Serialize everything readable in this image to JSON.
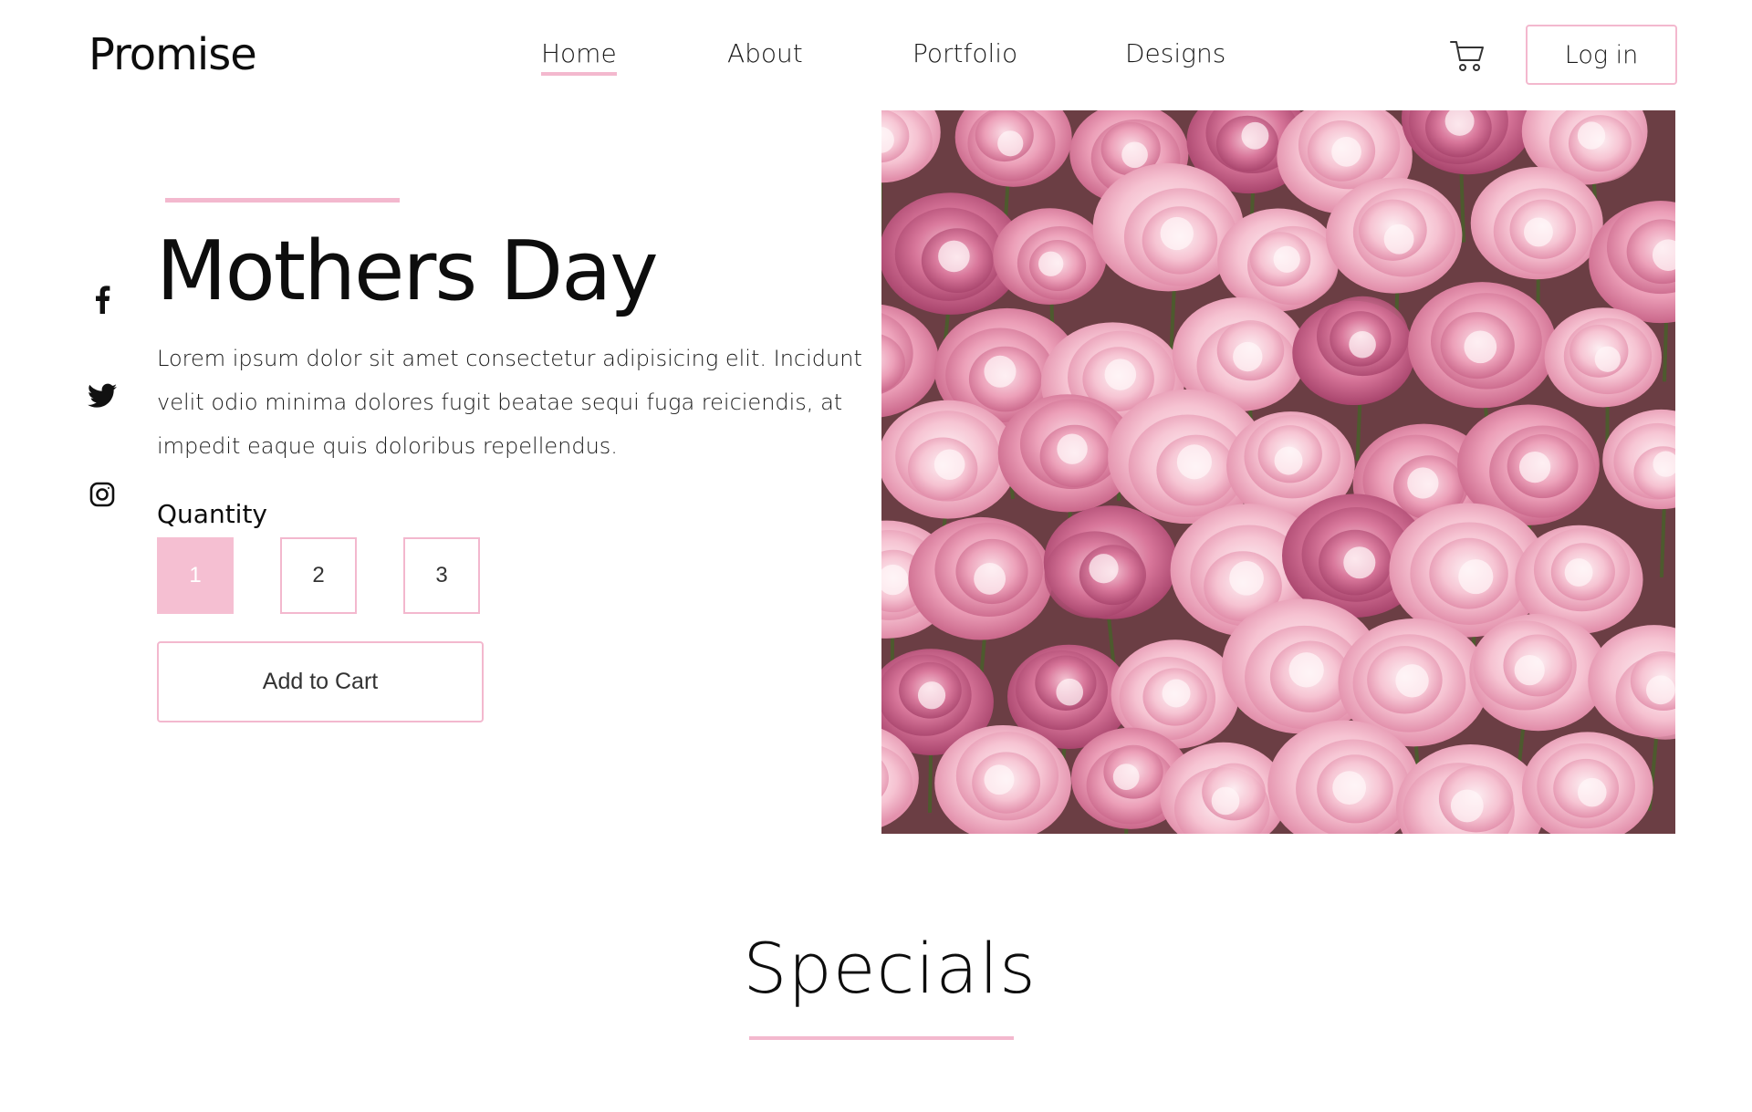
{
  "brand": {
    "name": "Promise"
  },
  "nav": {
    "items": [
      {
        "label": "Home",
        "active": true
      },
      {
        "label": "About"
      },
      {
        "label": "Portfolio"
      },
      {
        "label": "Designs"
      }
    ],
    "cart_icon": "shopping-cart-icon",
    "login_label": "Log in"
  },
  "social": [
    {
      "icon": "facebook-icon"
    },
    {
      "icon": "twitter-icon"
    },
    {
      "icon": "instagram-icon"
    }
  ],
  "hero": {
    "title": "Mothers Day",
    "description": "Lorem ipsum dolor sit amet consectetur adipisicing elit. Incidunt velit odio minima dolores fugit beatae sequi fuga reiciendis, at impedit eaque quis doloribus repellendus.",
    "quantity_label": "Quantity",
    "quantity_options": [
      "1",
      "2",
      "3"
    ],
    "selected_quantity": "1",
    "add_to_cart_label": "Add to Cart",
    "image": "pink-peony-flowers-photo"
  },
  "specials": {
    "title": "Specials"
  },
  "colors": {
    "accent_pink": "#f3b8ce",
    "selected_pink": "#f5bfd2",
    "text_dark": "#0d0d0d",
    "background": "#ffffff"
  }
}
